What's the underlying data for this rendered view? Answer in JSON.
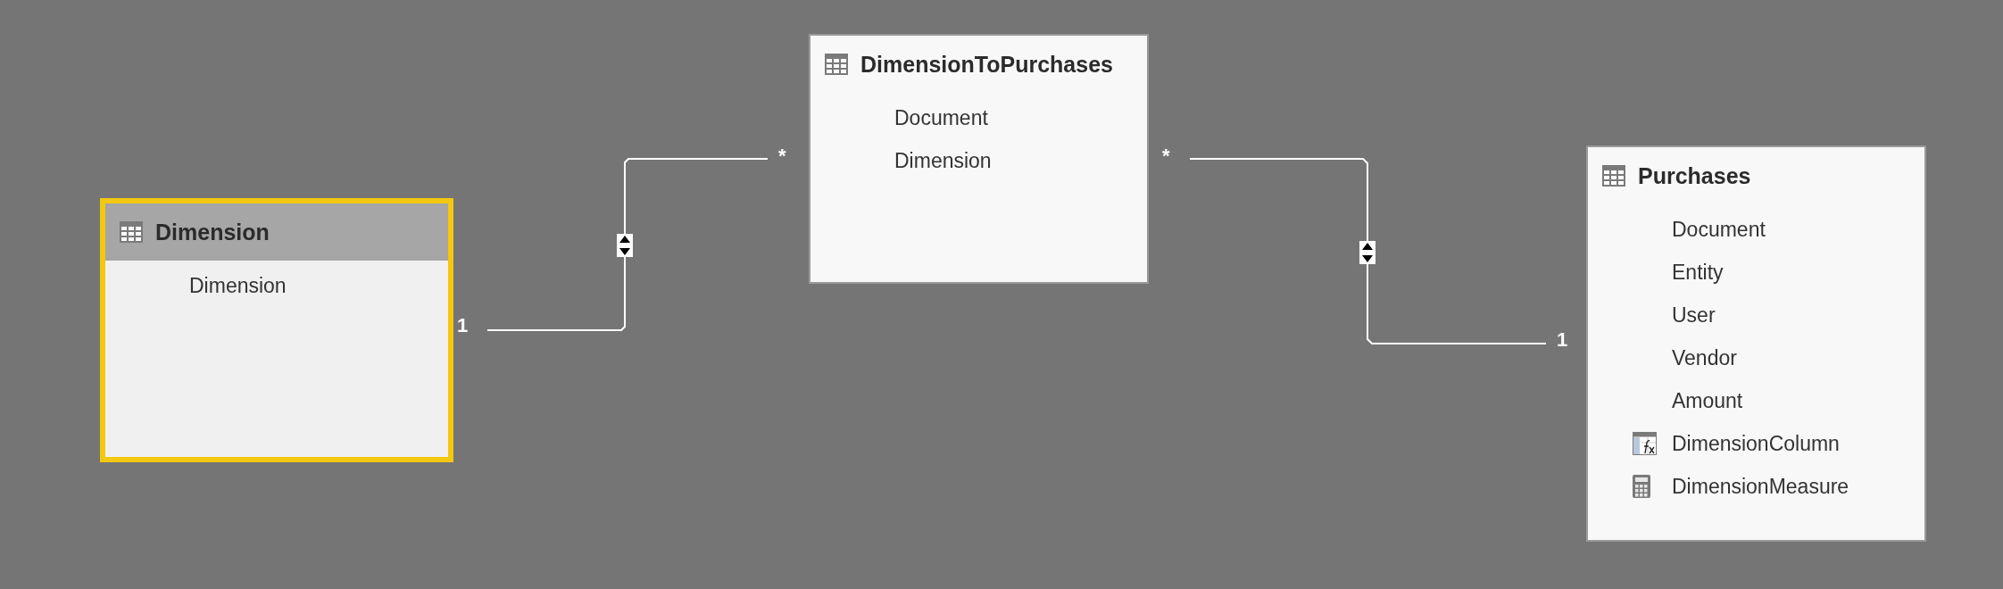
{
  "tables": [
    {
      "name": "Dimension",
      "selected": true,
      "columns": [
        {
          "name": "Dimension",
          "kind": "plain"
        }
      ]
    },
    {
      "name": "DimensionToPurchases",
      "selected": false,
      "columns": [
        {
          "name": "Document",
          "kind": "plain"
        },
        {
          "name": "Dimension",
          "kind": "plain"
        }
      ]
    },
    {
      "name": "Purchases",
      "selected": false,
      "columns": [
        {
          "name": "Document",
          "kind": "plain"
        },
        {
          "name": "Entity",
          "kind": "plain"
        },
        {
          "name": "User",
          "kind": "plain"
        },
        {
          "name": "Vendor",
          "kind": "plain"
        },
        {
          "name": "Amount",
          "kind": "plain"
        },
        {
          "name": "DimensionColumn",
          "kind": "calculated"
        },
        {
          "name": "DimensionMeasure",
          "kind": "measure"
        }
      ]
    }
  ],
  "relationships": [
    {
      "start_label": "1",
      "end_label": "*",
      "bidirectional": true
    },
    {
      "start_label": "*",
      "end_label": "1",
      "bidirectional": true
    }
  ]
}
